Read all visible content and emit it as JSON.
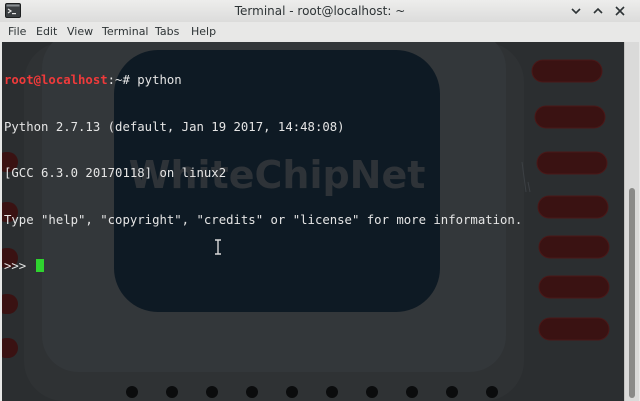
{
  "window": {
    "title": "Terminal - root@localhost: ~"
  },
  "menu": {
    "items": [
      "File",
      "Edit",
      "View",
      "Terminal",
      "Tabs",
      "Help"
    ]
  },
  "terminal": {
    "prompt_user_host": "root@localhost",
    "prompt_path": ":~#",
    "command": " python",
    "output": [
      "Python 2.7.13 (default, Jan 19 2017, 14:48:08)",
      "[GCC 6.3.0 20170118] on linux2",
      "Type \"help\", \"copyright\", \"credits\" or \"license\" for more information."
    ],
    "repl_prompt": ">>> ",
    "wallpaper_text": "WhiteChipNet"
  },
  "colors": {
    "terminal_bg": "#2b2e30",
    "prompt_red": "#f03a3a",
    "cursor_green": "#2fd32f",
    "text": "#e5e5e5"
  }
}
